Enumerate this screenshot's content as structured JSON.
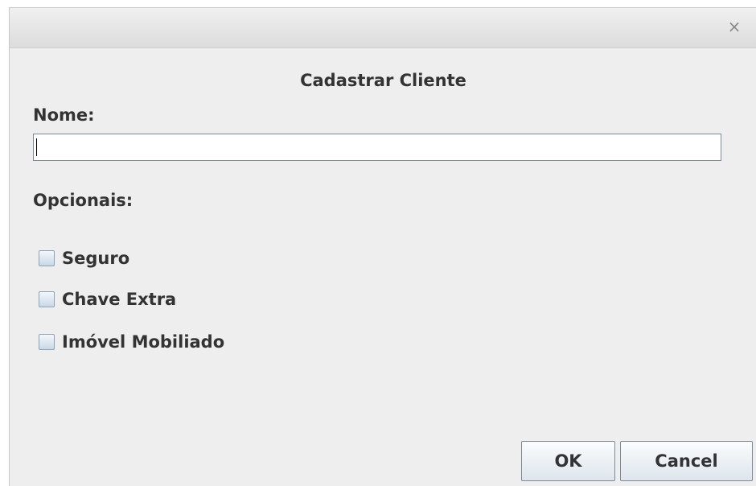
{
  "window": {
    "close_glyph": "×"
  },
  "dialog": {
    "title": "Cadastrar Cliente",
    "name_label": "Nome:",
    "name_value": "",
    "optionals_label": "Opcionais:",
    "options": [
      {
        "label": "Seguro",
        "checked": false
      },
      {
        "label": "Chave Extra",
        "checked": false
      },
      {
        "label": "Imóvel Mobiliado",
        "checked": false
      }
    ]
  },
  "buttons": {
    "ok_label": "OK",
    "cancel_label": "Cancel"
  }
}
